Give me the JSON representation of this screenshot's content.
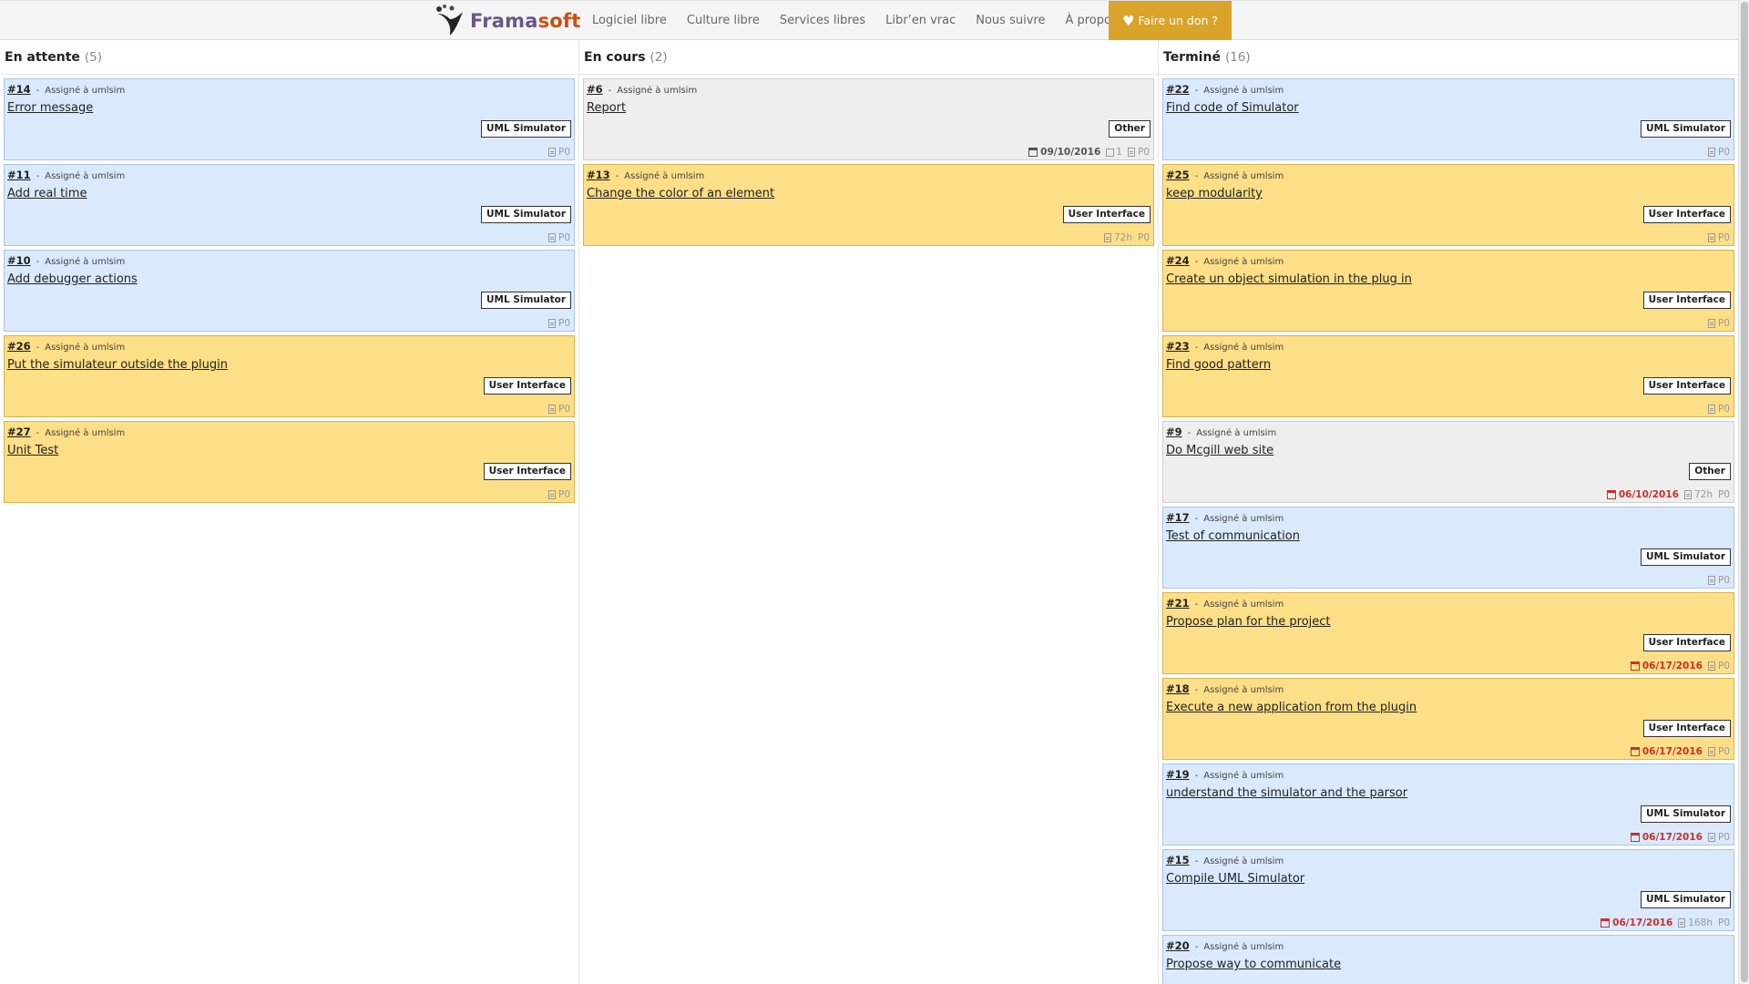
{
  "nav": {
    "brand_part1": "Frama",
    "brand_part2": "soft",
    "links": [
      "Logiciel libre",
      "Culture libre",
      "Services libres",
      "Libr’en vrac",
      "Nous suivre",
      "À propos"
    ],
    "donate_label": "Faire un don ?"
  },
  "colors": {
    "card_blue": "#daeafc",
    "card_yellow": "#fddf87",
    "card_grey": "#eeeeee",
    "donate": "#d9a42a",
    "overdue": "#c9302c"
  },
  "columns": [
    {
      "title": "En attente",
      "count": "(5)",
      "cards": [
        {
          "id": "#14",
          "assignee": "Assigné à umlsim",
          "title": "Error message",
          "category": "UML Simulator",
          "color": "blue",
          "date": "",
          "overdue": false,
          "ext": "",
          "hours": "",
          "priority": "P0"
        },
        {
          "id": "#11",
          "assignee": "Assigné à umlsim",
          "title": "Add real time",
          "category": "UML Simulator",
          "color": "blue",
          "date": "",
          "overdue": false,
          "ext": "",
          "hours": "",
          "priority": "P0"
        },
        {
          "id": "#10",
          "assignee": "Assigné à umlsim",
          "title": "Add debugger actions",
          "category": "UML Simulator",
          "color": "blue",
          "date": "",
          "overdue": false,
          "ext": "",
          "hours": "",
          "priority": "P0"
        },
        {
          "id": "#26",
          "assignee": "Assigné à umlsim",
          "title": "Put the simulateur outside the plugin",
          "category": "User Interface",
          "color": "yellow",
          "date": "",
          "overdue": false,
          "ext": "",
          "hours": "",
          "priority": "P0"
        },
        {
          "id": "#27",
          "assignee": "Assigné à umlsim",
          "title": "Unit Test",
          "category": "User Interface",
          "color": "yellow",
          "date": "",
          "overdue": false,
          "ext": "",
          "hours": "",
          "priority": "P0"
        }
      ]
    },
    {
      "title": "En cours",
      "count": "(2)",
      "cards": [
        {
          "id": "#6",
          "assignee": "Assigné à umlsim",
          "title": "Report",
          "category": "Other",
          "color": "grey",
          "date": "09/10/2016",
          "overdue": false,
          "ext": "1",
          "hours": "",
          "priority": "P0"
        },
        {
          "id": "#13",
          "assignee": "Assigné à umlsim",
          "title": "Change the color of an element",
          "category": "User Interface",
          "color": "yellow",
          "date": "",
          "overdue": false,
          "ext": "",
          "hours": "72h",
          "priority": "P0"
        }
      ]
    },
    {
      "title": "Terminé",
      "count": "(16)",
      "cards": [
        {
          "id": "#22",
          "assignee": "Assigné à umlsim",
          "title": "Find code of Simulator",
          "category": "UML Simulator",
          "color": "blue",
          "date": "",
          "overdue": false,
          "ext": "",
          "hours": "",
          "priority": "P0"
        },
        {
          "id": "#25",
          "assignee": "Assigné à umlsim",
          "title": "keep modularity",
          "category": "User Interface",
          "color": "yellow",
          "date": "",
          "overdue": false,
          "ext": "",
          "hours": "",
          "priority": "P0"
        },
        {
          "id": "#24",
          "assignee": "Assigné à umlsim",
          "title": "Create un object simulation in the plug in",
          "category": "User Interface",
          "color": "yellow",
          "date": "",
          "overdue": false,
          "ext": "",
          "hours": "",
          "priority": "P0"
        },
        {
          "id": "#23",
          "assignee": "Assigné à umlsim",
          "title": "Find good pattern",
          "category": "User Interface",
          "color": "yellow",
          "date": "",
          "overdue": false,
          "ext": "",
          "hours": "",
          "priority": "P0"
        },
        {
          "id": "#9",
          "assignee": "Assigné à umlsim",
          "title": "Do Mcgill web site",
          "category": "Other",
          "color": "grey",
          "date": "06/10/2016",
          "overdue": true,
          "ext": "",
          "hours": "72h",
          "priority": "P0"
        },
        {
          "id": "#17",
          "assignee": "Assigné à umlsim",
          "title": "Test of communication",
          "category": "UML Simulator",
          "color": "blue",
          "date": "",
          "overdue": false,
          "ext": "",
          "hours": "",
          "priority": "P0"
        },
        {
          "id": "#21",
          "assignee": "Assigné à umlsim",
          "title": "Propose plan for the project",
          "category": "User Interface",
          "color": "yellow",
          "date": "06/17/2016",
          "overdue": true,
          "ext": "",
          "hours": "",
          "priority": "P0"
        },
        {
          "id": "#18",
          "assignee": "Assigné à umlsim",
          "title": "Execute a new application from the plugin",
          "category": "User Interface",
          "color": "yellow",
          "date": "06/17/2016",
          "overdue": true,
          "ext": "",
          "hours": "",
          "priority": "P0"
        },
        {
          "id": "#19",
          "assignee": "Assigné à umlsim",
          "title": "understand the simulator and the parsor",
          "category": "UML Simulator",
          "color": "blue",
          "date": "06/17/2016",
          "overdue": true,
          "ext": "",
          "hours": "",
          "priority": "P0"
        },
        {
          "id": "#15",
          "assignee": "Assigné à umlsim",
          "title": "Compile UML Simulator",
          "category": "UML Simulator",
          "color": "blue",
          "date": "06/17/2016",
          "overdue": true,
          "ext": "",
          "hours": "168h",
          "priority": "P0"
        },
        {
          "id": "#20",
          "assignee": "Assigné à umlsim",
          "title": "Propose way to communicate",
          "category": "",
          "color": "blue",
          "date": "",
          "overdue": false,
          "ext": "",
          "hours": "",
          "priority": ""
        }
      ]
    }
  ]
}
